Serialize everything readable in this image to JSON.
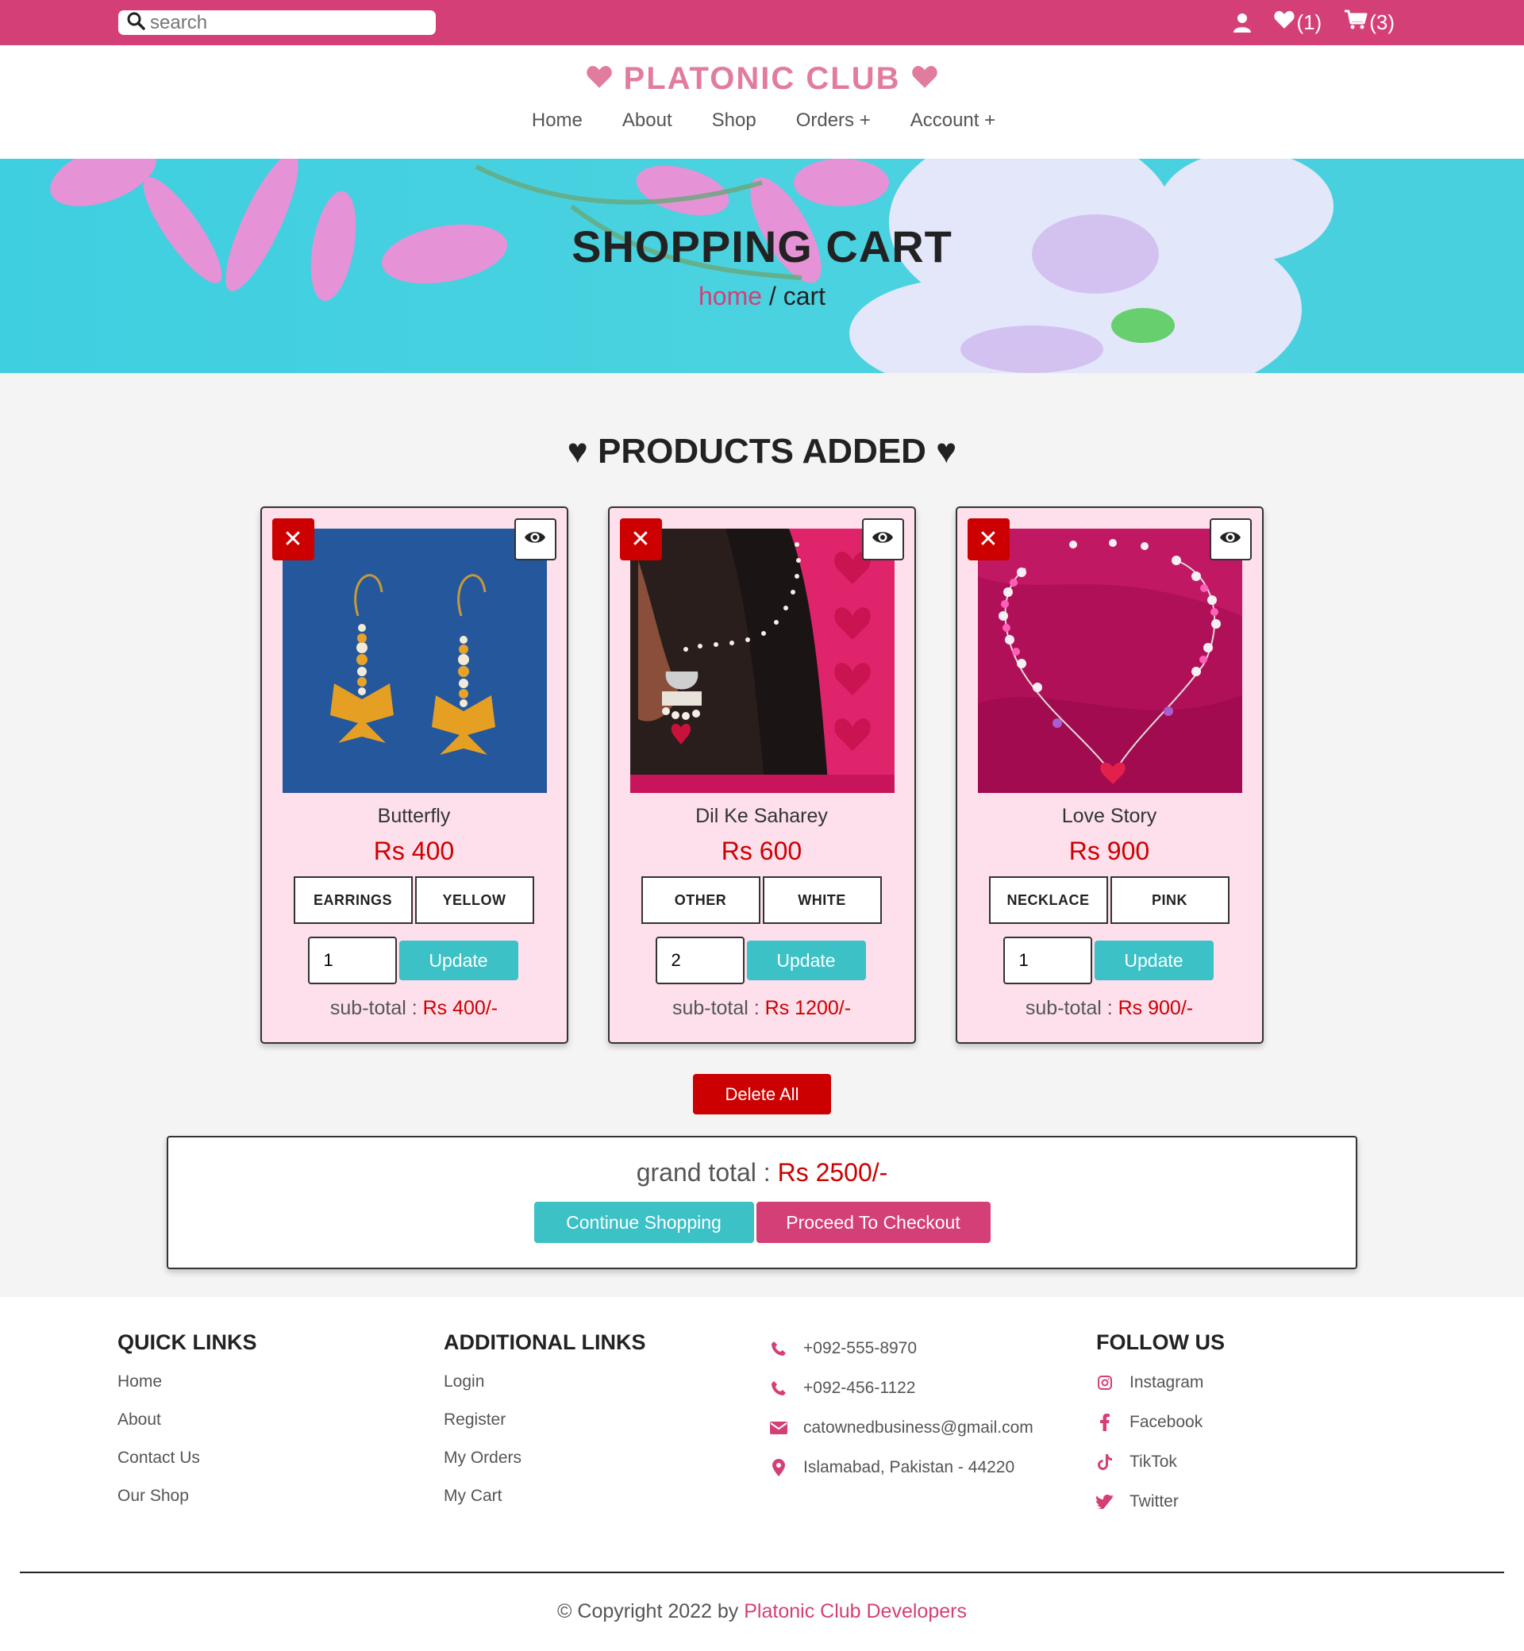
{
  "topbar": {
    "search_placeholder": "search",
    "wishlist_count": "(1)",
    "cart_count": "(3)"
  },
  "header": {
    "brand": "PLATONIC CLUB",
    "nav": [
      {
        "label": "Home"
      },
      {
        "label": "About"
      },
      {
        "label": "Shop"
      },
      {
        "label": "Orders +"
      },
      {
        "label": "Account +"
      }
    ]
  },
  "hero": {
    "title": "SHOPPING CART",
    "breadcrumb_home": "home",
    "breadcrumb_sep": " / ",
    "breadcrumb_current": "cart"
  },
  "products": {
    "section_title": "♥ PRODUCTS ADDED ♥",
    "items": [
      {
        "name": "Butterfly",
        "price": "Rs 400",
        "category": "EARRINGS",
        "color": "YELLOW",
        "qty": "1",
        "update": "Update",
        "subtotal_label": "sub-total : ",
        "subtotal_value": "Rs 400/-",
        "image": "butterfly-earrings"
      },
      {
        "name": "Dil Ke Saharey",
        "price": "Rs 600",
        "category": "OTHER",
        "color": "WHITE",
        "qty": "2",
        "update": "Update",
        "subtotal_label": "sub-total : ",
        "subtotal_value": "Rs 1200/-",
        "image": "ear-chain-jhumka"
      },
      {
        "name": "Love Story",
        "price": "Rs 900",
        "category": "NECKLACE",
        "color": "PINK",
        "qty": "1",
        "update": "Update",
        "subtotal_label": "sub-total : ",
        "subtotal_value": "Rs 900/-",
        "image": "heart-bead-necklace"
      }
    ],
    "delete_all": "Delete All"
  },
  "summary": {
    "grand_total_label": "grand total : ",
    "grand_total_value": "Rs 2500/-",
    "continue_label": "Continue Shopping",
    "checkout_label": "Proceed To Checkout"
  },
  "footer": {
    "quick_title": "QUICK LINKS",
    "quick_links": [
      "Home",
      "About",
      "Contact Us",
      "Our Shop"
    ],
    "additional_title": "ADDITIONAL LINKS",
    "additional_links": [
      "Login",
      "Register",
      "My Orders",
      "My Cart"
    ],
    "contact": [
      {
        "icon": "phone-icon",
        "text": "+092-555-8970"
      },
      {
        "icon": "phone-icon",
        "text": "+092-456-1122"
      },
      {
        "icon": "envelope-icon",
        "text": "catownedbusiness@gmail.com"
      },
      {
        "icon": "map-pin-icon",
        "text": "Islamabad, Pakistan - 44220"
      }
    ],
    "follow_title": "FOLLOW US",
    "social": [
      {
        "icon": "instagram-icon",
        "text": "Instagram"
      },
      {
        "icon": "facebook-icon",
        "text": "Facebook"
      },
      {
        "icon": "tiktok-icon",
        "text": "TikTok"
      },
      {
        "icon": "twitter-icon",
        "text": "Twitter"
      }
    ],
    "copyright_text": "© Copyright 2022 by ",
    "copyright_link": "Platonic Club Developers"
  },
  "colors": {
    "brand_pink": "#d53f77",
    "logo_pink": "#e27c9e",
    "teal": "#3cc1c6",
    "danger_red": "#cc0000",
    "card_bg": "#fde0ec"
  }
}
